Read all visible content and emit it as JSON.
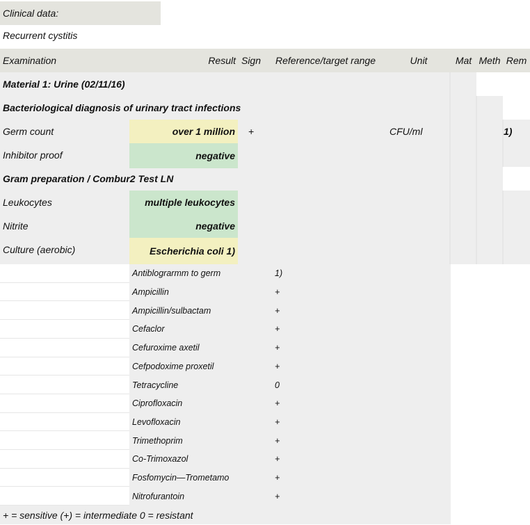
{
  "clinical": {
    "label": "Clinical data:",
    "value": "Recurrent cystitis"
  },
  "header": {
    "examination": "Examination",
    "result": "Result",
    "sign": "Sign",
    "reference": "Reference/target range",
    "unit": "Unit",
    "mat": "Mat",
    "meth": "Meth",
    "rem": "Rem"
  },
  "sections": {
    "material": "Material 1: Urine (02/11/16)",
    "bacteriological": "Bacteriological diagnosis of urinary tract infections",
    "gram": "Gram preparation / Combur2 Test LN"
  },
  "rows": [
    {
      "name": "Germ count",
      "result": "over 1 million",
      "sign": "+",
      "unit": "CFU/ml",
      "rem": "1)"
    },
    {
      "name": "Inhibitor proof",
      "result": "negative"
    },
    {
      "name": "Leukocytes",
      "result": "multiple leukocytes"
    },
    {
      "name": "Nitrite",
      "result": "negative"
    },
    {
      "name": "Culture (aerobic)",
      "result": "Escherichia coli 1)"
    }
  ],
  "antibiogram": [
    {
      "drug": "Antiblograrmm to germ",
      "value": "1)"
    },
    {
      "drug": "Ampicillin",
      "value": "+"
    },
    {
      "drug": "Ampicillin/sulbactam",
      "value": "+"
    },
    {
      "drug": "Cefaclor",
      "value": "+"
    },
    {
      "drug": "Cefuroxime axetil",
      "value": "+"
    },
    {
      "drug": "Cefpodoxime proxetil",
      "value": "+"
    },
    {
      "drug": "Tetracycline",
      "value": "0"
    },
    {
      "drug": "Ciprofloxacin",
      "value": "+"
    },
    {
      "drug": "Levofloxacin",
      "value": "+"
    },
    {
      "drug": "Trimethoprim",
      "value": "+"
    },
    {
      "drug": "Co-Trimoxazol",
      "value": "+"
    },
    {
      "drug": "Fosfomycin—Trometamo",
      "value": "+"
    },
    {
      "drug": "Nitrofurantoin",
      "value": "+"
    }
  ],
  "legend": "+ = sensitive (+) = intermediate 0 = resistant"
}
